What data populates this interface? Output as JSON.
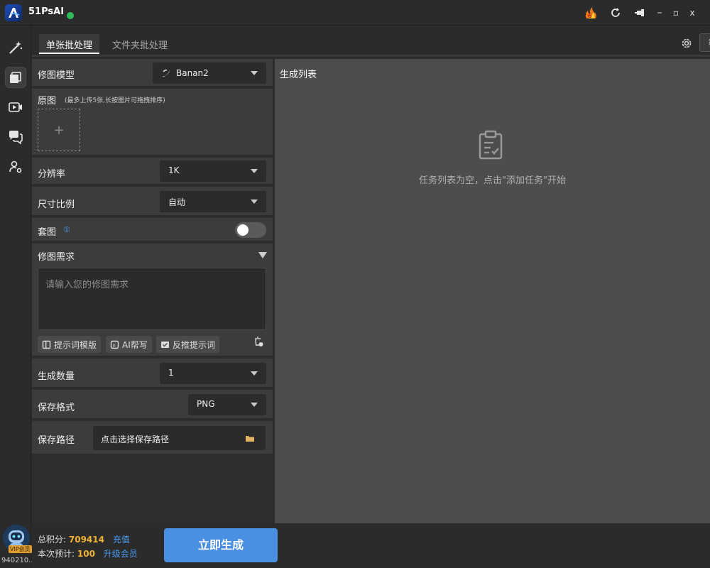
{
  "app": {
    "title": "51PsAI"
  },
  "titlebar": {
    "minimize": "–",
    "maximize": "▫",
    "close": "x"
  },
  "tabs": [
    {
      "label": "单张批处理"
    },
    {
      "label": "文件夹批处理"
    }
  ],
  "header": {
    "tutorial_label": "教程"
  },
  "left_panel": {
    "model": {
      "label": "修图模型",
      "value": "Banan2"
    },
    "original": {
      "label": "原图",
      "hint": "(最多上传5张,长按图片可拖拽排序)",
      "add": "+"
    },
    "resolution": {
      "label": "分辨率",
      "value": "1K"
    },
    "aspect": {
      "label": "尺寸比例",
      "value": "自动"
    },
    "template": {
      "label": "套图",
      "info": "①",
      "enabled": false
    },
    "requirement": {
      "label": "修图需求",
      "placeholder": "请输入您的修图需求",
      "buttons": [
        {
          "label": "提示词模版"
        },
        {
          "label": "AI帮写"
        },
        {
          "label": "反推提示词"
        }
      ]
    },
    "count": {
      "label": "生成数量",
      "value": "1"
    },
    "format": {
      "label": "保存格式",
      "value": "PNG"
    },
    "path": {
      "label": "保存路径",
      "value": "点击选择保存路径"
    }
  },
  "right_panel": {
    "title": "生成列表",
    "empty_text": "任务列表为空，点击\"添加任务\"开始"
  },
  "footer": {
    "total_label": "总积分:",
    "total_value": "709414",
    "recharge": "充值",
    "estimate_label": "本次预计:",
    "estimate_value": "100",
    "upgrade": "升级会员",
    "generate": "立即生成",
    "vip": "VIP会员",
    "user_id": "940210..."
  },
  "colors": {
    "accent": "#4a90e2",
    "score": "#f2b233",
    "link": "#4a9af0",
    "online": "#2ebd59"
  }
}
